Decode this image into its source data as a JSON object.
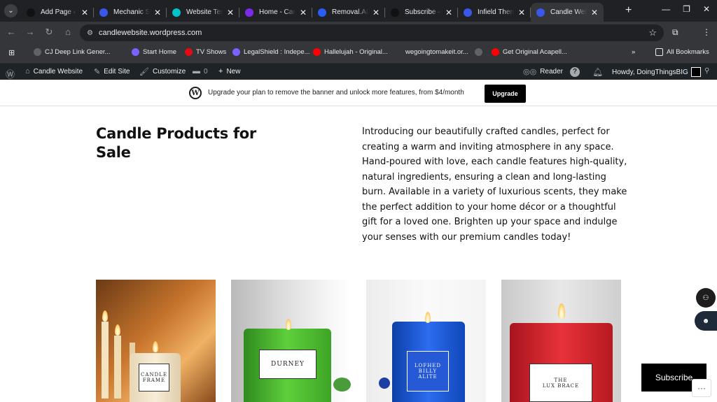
{
  "browser": {
    "tabs": [
      {
        "title": "Add Page ‹ S",
        "icon": "notion-icon",
        "color": "#111111"
      },
      {
        "title": "Mechanic Sh",
        "icon": "wordpress-icon",
        "color": "#3858e9"
      },
      {
        "title": "Website Tem",
        "icon": "canva-icon",
        "color": "#00c4cc"
      },
      {
        "title": "Home - Canv",
        "icon": "canva-icon",
        "color": "#7d2ae8"
      },
      {
        "title": "Removal.AI",
        "icon": "removal-ai-icon",
        "color": "#2c5cf6"
      },
      {
        "title": "Subscribe – ",
        "icon": "notion-icon",
        "color": "#111111"
      },
      {
        "title": "Infield Theme",
        "icon": "wordpress-icon",
        "color": "#3858e9"
      },
      {
        "title": "Candle Webs",
        "icon": "wordpress-icon",
        "color": "#3858e9",
        "active": true
      }
    ],
    "url": "candlewebsite.wordpress.com",
    "bookmarks": [
      {
        "label": "CJ Deep Link Gener...",
        "icon": "globe-icon"
      },
      {
        "label": "Start Home",
        "icon": "shield-icon"
      },
      {
        "label": "TV Shows",
        "icon": "netflix-icon"
      },
      {
        "label": "LegalShield : Indepe...",
        "icon": "shield-icon"
      },
      {
        "label": "Hallelujah - Original...",
        "icon": "youtube-icon"
      },
      {
        "label": "wegoingtomakeit.or...",
        "icon": "moon-icon"
      },
      {
        "label": "",
        "icon": "globe-icon"
      },
      {
        "label": "Get Original Acapell...",
        "icon": "youtube-icon"
      }
    ],
    "all_bookmarks": "All Bookmarks"
  },
  "wpbar": {
    "site": "Candle Website",
    "edit_site": "Edit Site",
    "customize": "Customize",
    "comments": "0",
    "new": "New",
    "reader": "Reader",
    "howdy": "Howdy, DoingThingsBIG"
  },
  "banner": {
    "message": "Upgrade your plan to remove the banner and unlock more features, from $4/month",
    "button": "Upgrade"
  },
  "page": {
    "heading": "Candle Products for Sale",
    "intro": "Introducing our beautifully crafted candles, perfect for creating a warm and inviting atmosphere in any space. Hand-poured with love, each candle features high-quality, natural ingredients, ensuring a clean and long-lasting burn. Available in a variety of luxurious scents, they make the perfect addition to your home décor or a thoughtful gift for a loved one. Brighten up your space and indulge your senses with our premium candles today!",
    "products": [
      {
        "label": "CANDLE\nFRAME",
        "color": "#f1e3c8"
      },
      {
        "label": "DURNEY",
        "color": "#3fa52c"
      },
      {
        "label": "LOFHED\nBILLY\nALITE",
        "color": "#1b52c9"
      },
      {
        "label": "THE\nLUX BRACE",
        "color": "#d91f2a"
      }
    ]
  },
  "subscribe": "Subscribe"
}
